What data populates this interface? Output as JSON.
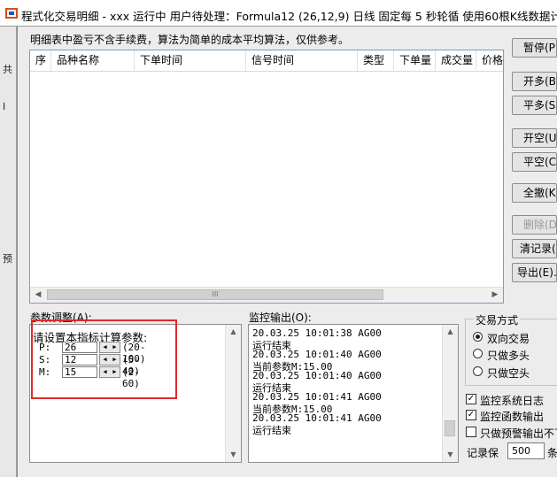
{
  "window": {
    "title": "程式化交易明细 - xxx 运行中  用户待处理：Formula12 (26,12,9) 日线 固定每 5 秒轮循 使用60根K线数据计算"
  },
  "background": {
    "text_1": "共",
    "text_2": "预",
    "text_3": "I"
  },
  "note": "明细表中盈亏不含手续费，算法为简单的成本平均算法，仅供参考。",
  "table": {
    "columns": [
      "序",
      "品种名称",
      "下单时间",
      "信号时间",
      "类型",
      "下单量",
      "成交量",
      "价格"
    ],
    "rows": [],
    "scroll_thumb_glyph": "III"
  },
  "buttons": {
    "pause": "暂停(P)",
    "open_long": "开多(B)",
    "close_long": "平多(S)",
    "open_short": "开空(U)",
    "close_short": "平空(C)",
    "cancel_all": "全撤(K)",
    "delete": "删除(D)",
    "clear_records": "清记录(L)",
    "export": "导出(E)..."
  },
  "params": {
    "title": "参数调整(A):",
    "prompt": "请设置本指标计算参数:",
    "items": [
      {
        "name": "P:",
        "value": "26",
        "range": "(20-100)"
      },
      {
        "name": "S:",
        "value": "12",
        "range": "(5-40)"
      },
      {
        "name": "M:",
        "value": "15",
        "range": "(2-60)"
      }
    ],
    "spin_left": "◀",
    "spin_right": "▶"
  },
  "monitor": {
    "title": "监控输出(O):",
    "lines": [
      "20.03.25 10:01:38 AG00",
      "运行结束",
      "20.03.25 10:01:40 AG00",
      "当前参数M:15.00",
      "20.03.25 10:01:40 AG00",
      "运行结束",
      "20.03.25 10:01:41 AG00",
      "当前参数M:15.00",
      "20.03.25 10:01:41 AG00",
      "运行结束"
    ]
  },
  "trade_mode": {
    "title": "交易方式",
    "options": [
      "双向交易",
      "只做多头",
      "只做空头"
    ],
    "selected": 0
  },
  "options": {
    "monitor_log": {
      "label": "监控系统日志",
      "checked": true
    },
    "monitor_func": {
      "label": "监控函数输出",
      "checked": true
    },
    "alert_only": {
      "label": "只做预警输出不下单",
      "checked": false
    }
  },
  "records": {
    "label": "记录保",
    "value": "500",
    "unit": "条"
  },
  "colors": {
    "highlight_box": "#e0292b",
    "accent_blue": "#1a56c4"
  }
}
